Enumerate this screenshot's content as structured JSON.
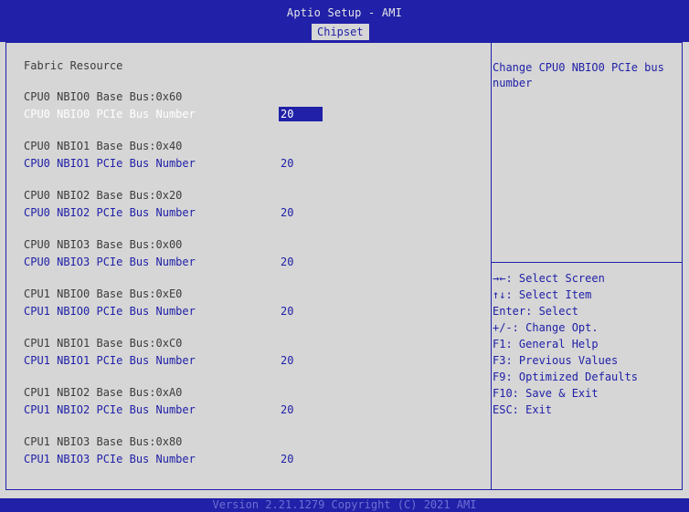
{
  "header": {
    "app_title": "Aptio Setup - AMI",
    "active_tab": "Chipset"
  },
  "main": {
    "heading": "Fabric Resource",
    "groups": [
      {
        "base": "CPU0 NBIO0 Base Bus:0x60",
        "option": "CPU0 NBIO0 PCIe Bus Number",
        "value": "20",
        "selected": true
      },
      {
        "base": "CPU0 NBIO1 Base Bus:0x40",
        "option": "CPU0 NBIO1 PCIe Bus Number",
        "value": "20"
      },
      {
        "base": "CPU0 NBIO2 Base Bus:0x20",
        "option": "CPU0 NBIO2 PCIe Bus Number",
        "value": "20"
      },
      {
        "base": "CPU0 NBIO3 Base Bus:0x00",
        "option": "CPU0 NBIO3 PCIe Bus Number",
        "value": "20"
      },
      {
        "base": "CPU1 NBIO0 Base Bus:0xE0",
        "option": "CPU1 NBIO0 PCIe Bus Number",
        "value": "20"
      },
      {
        "base": "CPU1 NBIO1 Base Bus:0xC0",
        "option": "CPU1 NBIO1 PCIe Bus Number",
        "value": "20"
      },
      {
        "base": "CPU1 NBIO2 Base Bus:0xA0",
        "option": "CPU1 NBIO2 PCIe Bus Number",
        "value": "20"
      },
      {
        "base": "CPU1 NBIO3 Base Bus:0x80",
        "option": "CPU1 NBIO3 PCIe Bus Number",
        "value": "20"
      }
    ]
  },
  "help": {
    "line1": "Change CPU0 NBIO0 PCIe bus",
    "line2": "number"
  },
  "keys": [
    "→←: Select Screen",
    "↑↓: Select Item",
    "Enter: Select",
    "+/-: Change Opt.",
    "F1: General Help",
    "F3: Previous Values",
    "F9: Optimized Defaults",
    "F10: Save & Exit",
    "ESC: Exit"
  ],
  "footer": {
    "version": "Version 2.21.1279 Copyright (C) 2021 AMI"
  },
  "colors": {
    "bar_blue": "#2020a8",
    "panel_gray": "#d6d6d6",
    "text_dark": "#3c3c3c"
  }
}
